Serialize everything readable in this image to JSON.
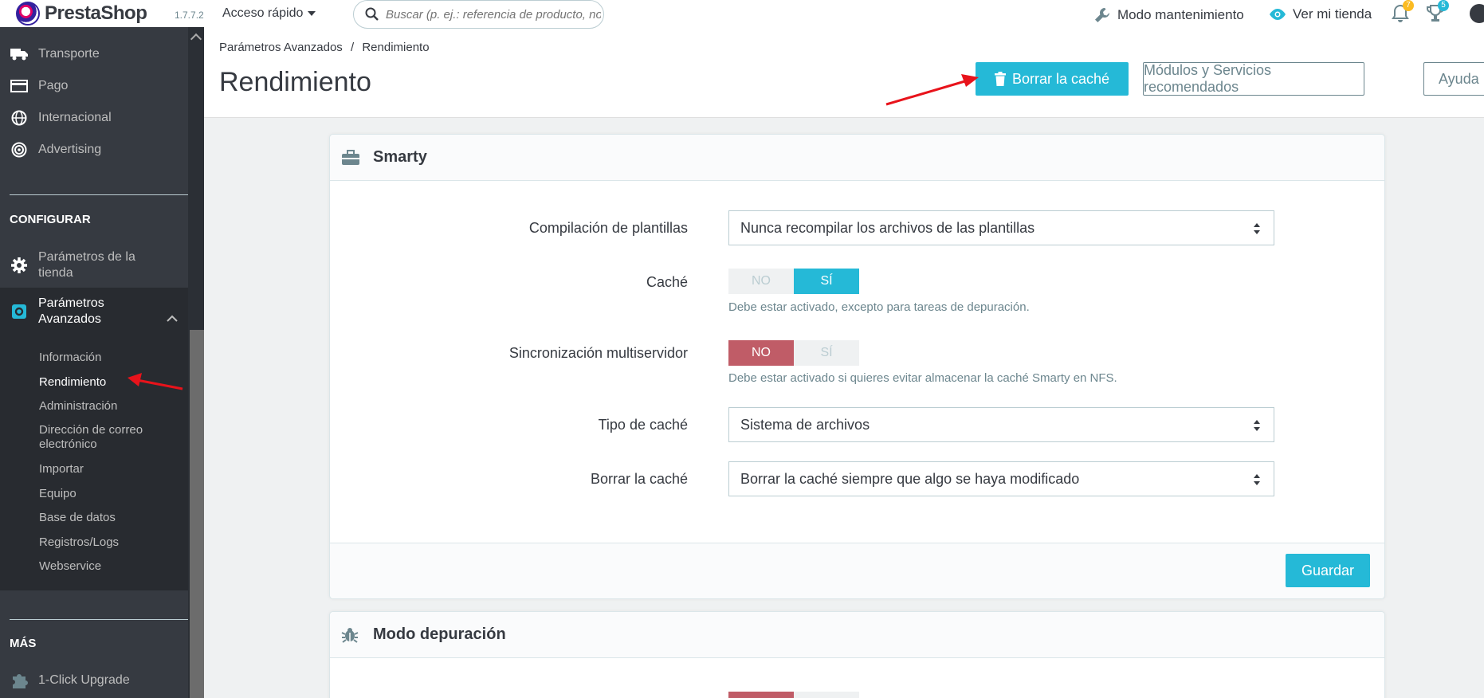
{
  "header": {
    "brand": "PrestaShop",
    "version": "1.7.7.2",
    "quick_access": "Acceso rápido",
    "search_placeholder": "Buscar (p. ej.: referencia de producto, nombre de cliente…)",
    "maintenance": "Modo mantenimiento",
    "view_store": "Ver mi tienda",
    "notifications_count": "7",
    "trophies_count": "5"
  },
  "sidebar": {
    "items_top": [
      {
        "label": "Transporte",
        "icon": "truck-icon"
      },
      {
        "label": "Pago",
        "icon": "credit-card-icon"
      },
      {
        "label": "Internacional",
        "icon": "globe-icon"
      },
      {
        "label": "Advertising",
        "icon": "target-icon"
      }
    ],
    "section_configure": "CONFIGURAR",
    "store_params": "Parámetros de la tienda",
    "advanced_params": "Parámetros Avanzados",
    "sub_items": [
      "Información",
      "Rendimiento",
      "Administración",
      "Dirección de correo electrónico",
      "Importar",
      "Equipo",
      "Base de datos",
      "Registros/Logs",
      "Webservice"
    ],
    "section_more": "MÁS",
    "upgrade": "1-Click Upgrade"
  },
  "toolbar": {
    "breadcrumb_parent": "Parámetros Avanzados",
    "breadcrumb_sep": "/",
    "breadcrumb_current": "Rendimiento",
    "title": "Rendimiento",
    "clear_cache": "Borrar la caché",
    "recommended": "Módulos y Servicios recomendados",
    "help": "Ayuda"
  },
  "smarty": {
    "title": "Smarty",
    "compilation_label": "Compilación de plantillas",
    "compilation_value": "Nunca recompilar los archivos de las plantillas",
    "cache_label": "Caché",
    "cache_no": "NO",
    "cache_yes": "SÍ",
    "cache_help": "Debe estar activado, excepto para tareas de depuración.",
    "multiserver_label": "Sincronización multiservidor",
    "multiserver_no": "NO",
    "multiserver_yes": "SÍ",
    "multiserver_help": "Debe estar activado si quieres evitar almacenar la caché Smarty en NFS.",
    "cache_type_label": "Tipo de caché",
    "cache_type_value": "Sistema de archivos",
    "clear_label": "Borrar la caché",
    "clear_value": "Borrar la caché siempre que algo se haya modificado",
    "save": "Guardar"
  },
  "debug": {
    "title": "Modo depuración"
  },
  "colors": {
    "accent": "#25b9d7",
    "danger": "#c05c67",
    "sidebar": "#363a41",
    "annotation": "#e8131b"
  }
}
